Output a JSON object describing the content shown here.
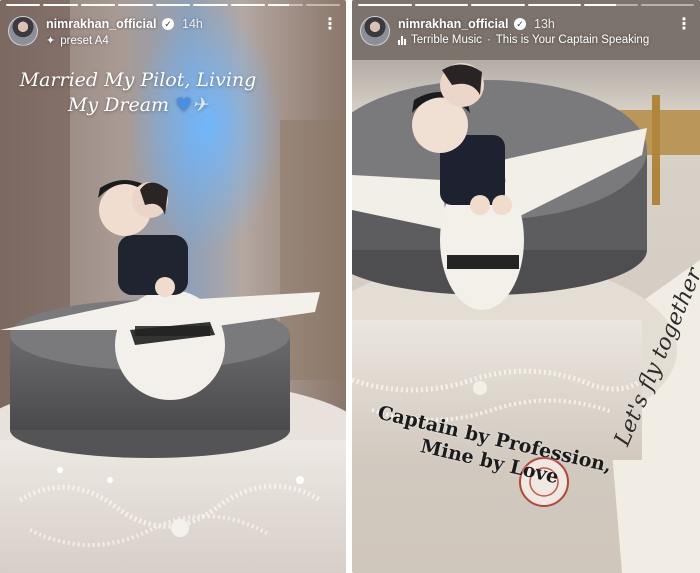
{
  "stories": [
    {
      "username": "nimrakhan_official",
      "time": "14h",
      "subline_text": "preset A4",
      "subline_icon": "sparkle-icon",
      "caption": "Married My Pilot, Living My Dream",
      "caption_emoji": [
        "blue-heart-icon",
        "airplane-icon"
      ],
      "progress_segments": 9,
      "active_segment": 8
    },
    {
      "username": "nimrakhan_official",
      "time": "13h",
      "music_artist": "Terrible Music",
      "music_separator": "·",
      "music_title": "This is Your Captain Speaking",
      "caption_line1": "Captain by Profession,",
      "caption_line2": "Mine by Love",
      "cake_sign_text": "Let's fly together...",
      "progress_segments": 6,
      "active_segment": 5
    }
  ],
  "colors": {
    "text": "#ffffff",
    "caption_dark": "#1b1b1b",
    "heart": "#4a90e2"
  }
}
